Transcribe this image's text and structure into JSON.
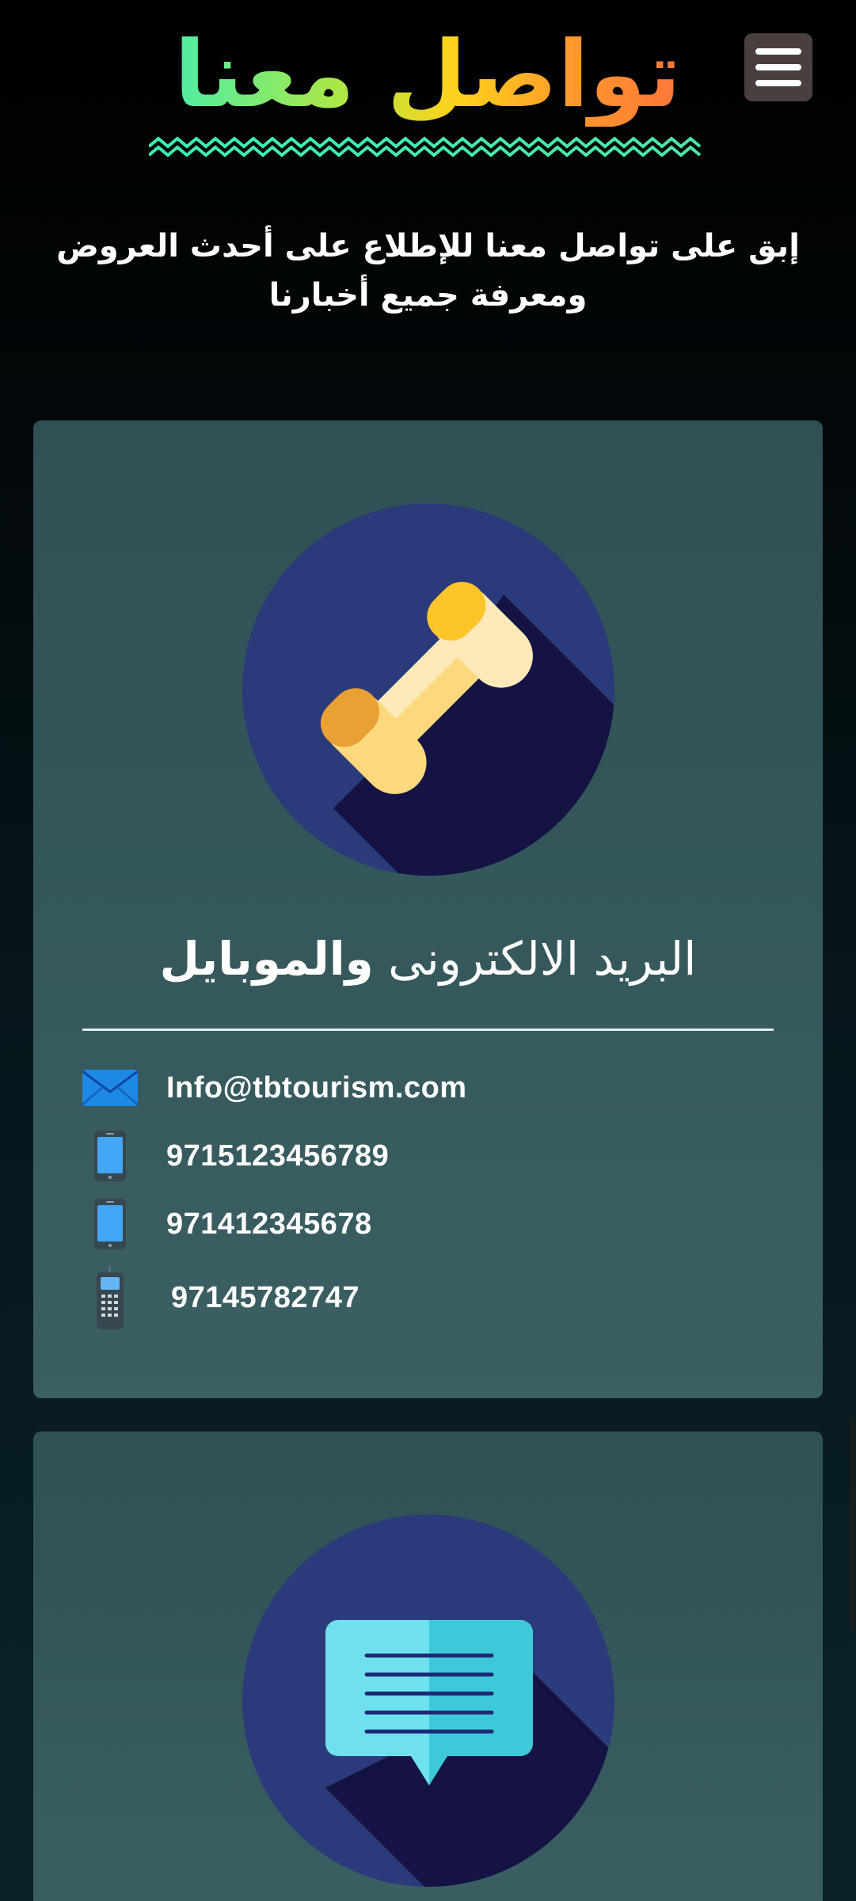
{
  "header": {
    "title": "تواصل معنا",
    "menu_icon": "hamburger-menu-icon"
  },
  "intro": {
    "text": "إبق على تواصل معنا للإطلاع على أحدث العروض ومعرفة جميع أخبارنا"
  },
  "cards": [
    {
      "icon": "phone-icon",
      "heading_light": "البريد الالكترونى",
      "heading_bold": "والموبايل",
      "contacts": [
        {
          "icon": "email-envelope-icon",
          "value": "Info@tbtourism.com"
        },
        {
          "icon": "mobile-phone-icon",
          "value": "9715123456789"
        },
        {
          "icon": "mobile-phone-icon",
          "value": "971412345678"
        },
        {
          "icon": "landline-phone-icon",
          "value": "97145782747"
        }
      ]
    },
    {
      "icon": "chat-message-icon"
    }
  ],
  "colors": {
    "title_gradient": [
      "#ff6a3d",
      "#ffd21c",
      "#3af0b8"
    ],
    "card_background": "#3b5f63",
    "icon_circle": "#2b3a7a",
    "icon_shadow": "#141344"
  }
}
